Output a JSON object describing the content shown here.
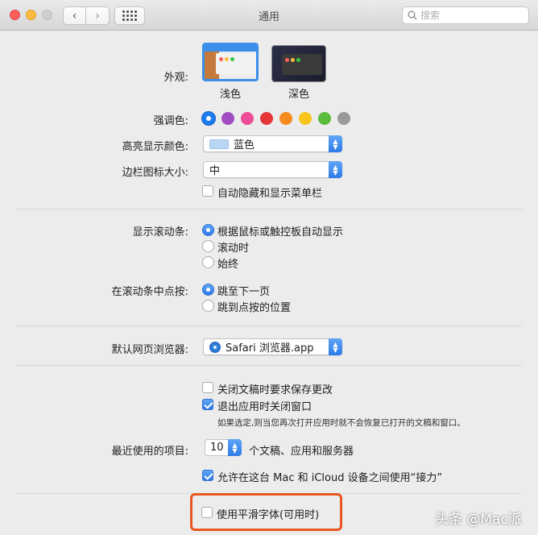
{
  "window": {
    "title": "通用"
  },
  "toolbar": {
    "search_placeholder": "搜索"
  },
  "appearance": {
    "label": "外观:",
    "options": [
      {
        "label": "浅色",
        "selected": true
      },
      {
        "label": "深色",
        "selected": false
      }
    ]
  },
  "accent": {
    "label": "强调色:",
    "colors": [
      "#1a7cf0",
      "#a04cc0",
      "#ee4c96",
      "#e5373a",
      "#f58a1e",
      "#f8c51c",
      "#5bbb3b",
      "#9a9a9a"
    ],
    "selected_index": 0
  },
  "highlight": {
    "label": "高亮显示颜色:",
    "value": "蓝色"
  },
  "sidebar_icon": {
    "label": "边栏图标大小:",
    "value": "中"
  },
  "menubar": {
    "label": "自动隐藏和显示菜单栏",
    "checked": false
  },
  "scrollbars": {
    "label": "显示滚动条:",
    "options": [
      {
        "label": "根据鼠标或触控板自动显示",
        "selected": true
      },
      {
        "label": "滚动时",
        "selected": false
      },
      {
        "label": "始终",
        "selected": false
      }
    ]
  },
  "scroll_click": {
    "label": "在滚动条中点按:",
    "options": [
      {
        "label": "跳至下一页",
        "selected": true
      },
      {
        "label": "跳到点按的位置",
        "selected": false
      }
    ]
  },
  "browser": {
    "label": "默认网页浏览器:",
    "value": "Safari 浏览器.app"
  },
  "docs": {
    "ask_save": {
      "label": "关闭文稿时要求保存更改",
      "checked": false
    },
    "close_windows": {
      "label": "退出应用时关闭窗口",
      "checked": true
    },
    "note": "如果选定,则当您再次打开应用时就不会恢复已打开的文稿和窗口。"
  },
  "recent": {
    "label": "最近使用的项目:",
    "value": "10",
    "suffix": "个文稿、应用和服务器"
  },
  "handoff": {
    "label": "允许在这台 Mac 和 iCloud 设备之间使用“接力”",
    "checked": true
  },
  "font_smoothing": {
    "label": "使用平滑字体(可用时)",
    "checked": false
  },
  "watermark": "头条 @Mac派",
  "colors": {
    "accent": "#2d7ae8",
    "annotation": "#e8571f"
  }
}
